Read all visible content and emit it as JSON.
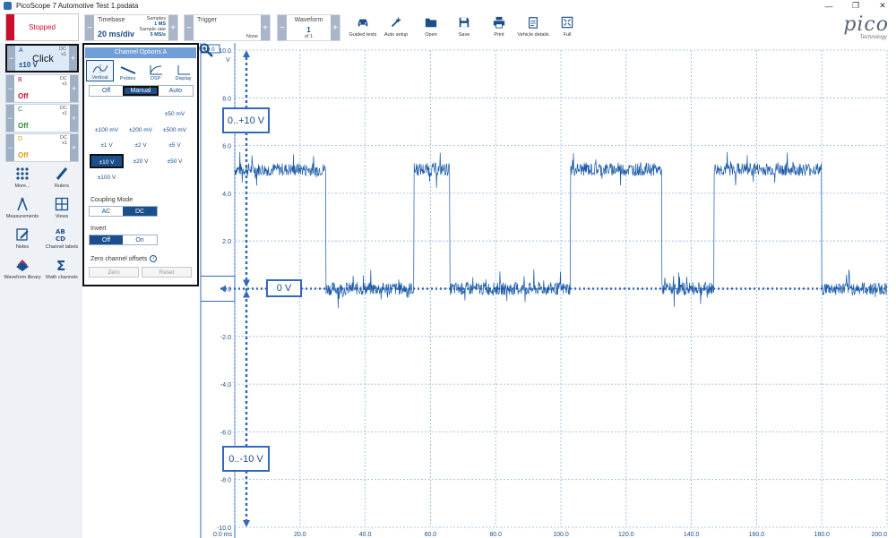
{
  "window": {
    "title": "PicoScope 7 Automotive Test 1.psdata",
    "minimize": "—",
    "restore": "❐",
    "close": "✕"
  },
  "toolbar": {
    "stop_label": "Stopped",
    "timebase": {
      "label": "Timebase",
      "value": "20 ms/div",
      "samples_label": "Samples",
      "samples_value": "1 MS",
      "rate_label": "Sample rate",
      "rate_value": "5 MS/s"
    },
    "trigger": {
      "label": "Trigger",
      "value": "None"
    },
    "waveform": {
      "label": "Waveform",
      "value": "1",
      "of": "of 1"
    },
    "tools": [
      {
        "label": "Guided tests",
        "icon": "car-icon"
      },
      {
        "label": "Auto setup",
        "icon": "wand-icon"
      },
      {
        "label": "Open",
        "icon": "folder-icon"
      },
      {
        "label": "Save",
        "icon": "save-icon"
      },
      {
        "label": "Print",
        "icon": "printer-icon"
      },
      {
        "label": "Vehicle details",
        "icon": "clipboard-icon"
      },
      {
        "label": "Full",
        "icon": "fullscreen-icon"
      }
    ],
    "logo": {
      "word": "pico",
      "tech": "Technology"
    }
  },
  "channels": [
    {
      "letter": "A",
      "coupling": "DC",
      "probe": "x1",
      "state": "±10 V",
      "color": "#1a4f8b",
      "annotation": "Click"
    },
    {
      "letter": "B",
      "coupling": "DC",
      "probe": "x1",
      "state": "Off",
      "color": "#c8102e"
    },
    {
      "letter": "C",
      "coupling": "DC",
      "probe": "x1",
      "state": "Off",
      "color": "#2e8b2e"
    },
    {
      "letter": "D",
      "coupling": "DC",
      "probe": "x1",
      "state": "Off",
      "color": "#d4a017"
    }
  ],
  "side_tools": [
    {
      "label": "More...",
      "icon": "more-icon"
    },
    {
      "label": "Rulers",
      "icon": "ruler-icon"
    },
    {
      "label": "Measurements",
      "icon": "measure-icon"
    },
    {
      "label": "Views",
      "icon": "views-icon"
    },
    {
      "label": "Notes",
      "icon": "notes-icon"
    },
    {
      "label": "Channel labels",
      "icon": "abcd-icon"
    },
    {
      "label": "Waveform library",
      "icon": "library-icon"
    },
    {
      "label": "Math channels",
      "icon": "sigma-icon"
    }
  ],
  "panel": {
    "title": "Channel Options A",
    "tabs": [
      "Vertical",
      "Probes",
      "DSP",
      "Display"
    ],
    "mode": [
      "Off",
      "Manual",
      "Auto"
    ],
    "ranges": [
      "±50 mV",
      "±100 mV",
      "±200 mV",
      "±500 mV",
      "±1 V",
      "±2 V",
      "±5 V",
      "±10 V",
      "±20 V",
      "±50 V",
      "±100 V"
    ],
    "selected_range": "±10 V",
    "coupling_label": "Coupling Mode",
    "coupling": [
      "AC",
      "DC"
    ],
    "invert_label": "Invert",
    "invert": [
      "Off",
      "On"
    ],
    "zero_label": "Zero channel offsets",
    "zero_btn": "Zero",
    "reset_btn": "Reset"
  },
  "annotations": {
    "top": "0..+10 V",
    "zero": "0 V",
    "bottom": "0..-10 V"
  },
  "chart_data": {
    "type": "line",
    "xlabel": "",
    "ylabel": "V",
    "xlim": [
      0,
      200
    ],
    "ylim": [
      -10,
      10
    ],
    "x_ticks": [
      "0.0 ms",
      "20.0",
      "40.0",
      "60.0",
      "80.0",
      "100.0",
      "120.0",
      "140.0",
      "160.0",
      "180.0",
      "200.0"
    ],
    "y_ticks": [
      "10.0",
      "8.0",
      "6.0",
      "4.0",
      "2.0",
      "0.0",
      "-2.0",
      "-4.0",
      "-6.0",
      "-8.0",
      "-10.0"
    ],
    "y_unit": "V",
    "grid": true,
    "series": [
      {
        "color": "#1a5aa8",
        "high_level": 5.0,
        "low_level": 0.0,
        "high_segments": [
          [
            0,
            28
          ],
          [
            55,
            66
          ],
          [
            103,
            131
          ],
          [
            147,
            180
          ]
        ]
      }
    ]
  }
}
